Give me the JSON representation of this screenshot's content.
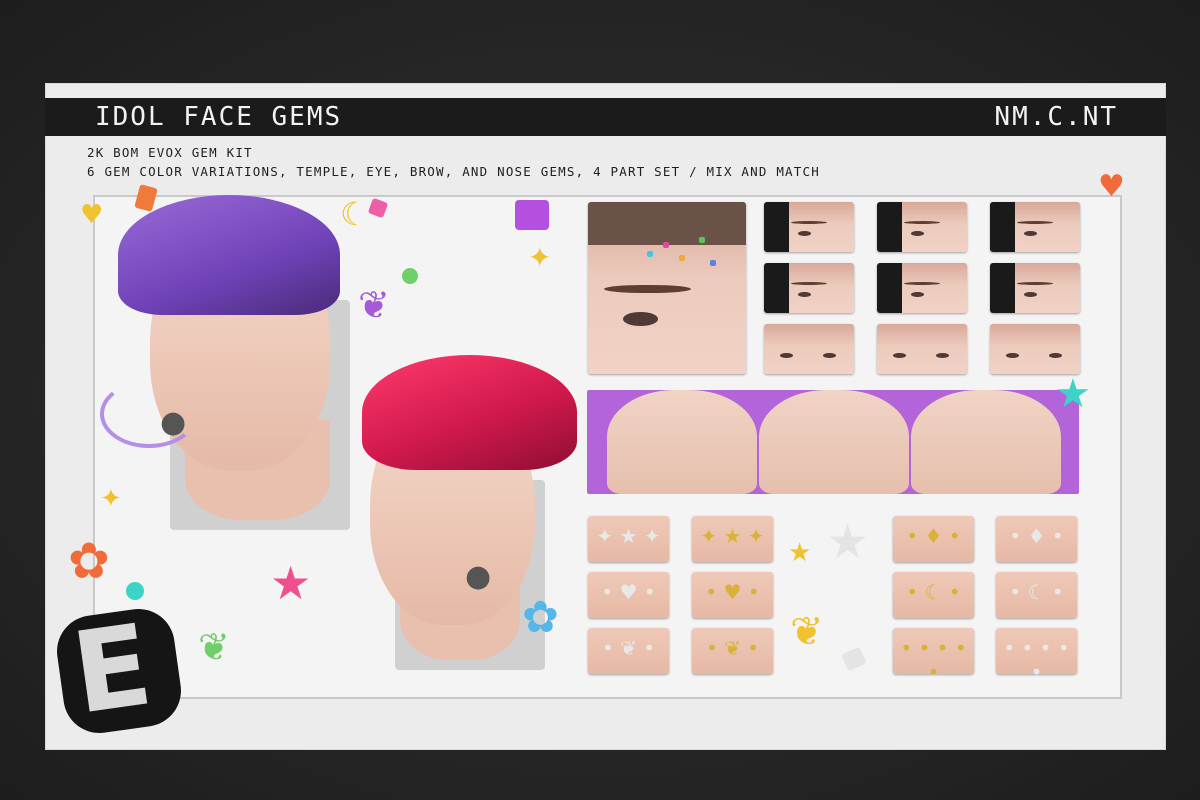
{
  "header": {
    "title": "IDOL FACE GEMS",
    "brand": "NM.C.NT"
  },
  "subtitle": {
    "line1": "2K BOM EVOX GEM KIT",
    "line2": "6 GEM COLOR VARIATIONS, TEMPLE, EYE, BROW, AND NOSE GEMS, 4 PART SET / MIX AND MATCH"
  },
  "colors": {
    "background": "#2a2a2a",
    "card": "#ececec",
    "header_bar": "#1b1b1b",
    "purple_hair": "#7a4cc4",
    "red_hair": "#d81b50",
    "strip": "#b264d8"
  },
  "logo": {
    "letter": "E"
  },
  "decorations": {
    "heart": "♥",
    "star": "★",
    "moon": "☾",
    "butterfly": "❦",
    "flower": "✿",
    "sparkle": "✦"
  }
}
